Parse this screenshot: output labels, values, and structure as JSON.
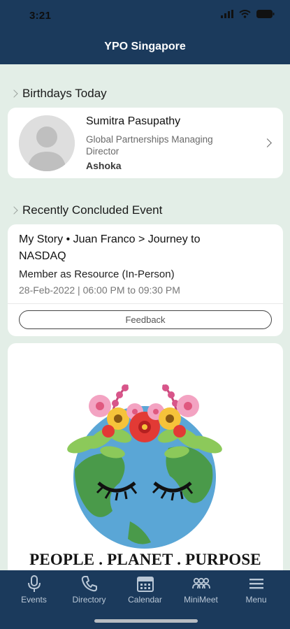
{
  "status_bar": {
    "time": "3:21"
  },
  "header": {
    "title": "YPO Singapore"
  },
  "birthdays": {
    "section_title": "Birthdays Today",
    "person": {
      "name": "Sumitra Pasupathy",
      "role": "Global Partnerships Managing Director",
      "organization": "Ashoka"
    }
  },
  "recent_event": {
    "section_title": "Recently Concluded Event",
    "title": "My Story • Juan Franco > Journey to NASDAQ",
    "type": "Member as Resource (In-Person)",
    "datetime": "28-Feb-2022 | 06:00 PM to 09:30 PM",
    "feedback_label": "Feedback"
  },
  "banner": {
    "caption": "PEOPLE . PLANET . PURPOSE"
  },
  "tabbar": {
    "tabs": [
      {
        "label": "Events",
        "icon": "microphone-icon"
      },
      {
        "label": "Directory",
        "icon": "phone-icon"
      },
      {
        "label": "Calendar",
        "icon": "calendar-icon"
      },
      {
        "label": "MiniMeet",
        "icon": "group-icon"
      },
      {
        "label": "Menu",
        "icon": "hamburger-icon"
      }
    ]
  },
  "colors": {
    "nav": "#1b3a5c",
    "background": "#e3eee7",
    "card": "#ffffff"
  }
}
